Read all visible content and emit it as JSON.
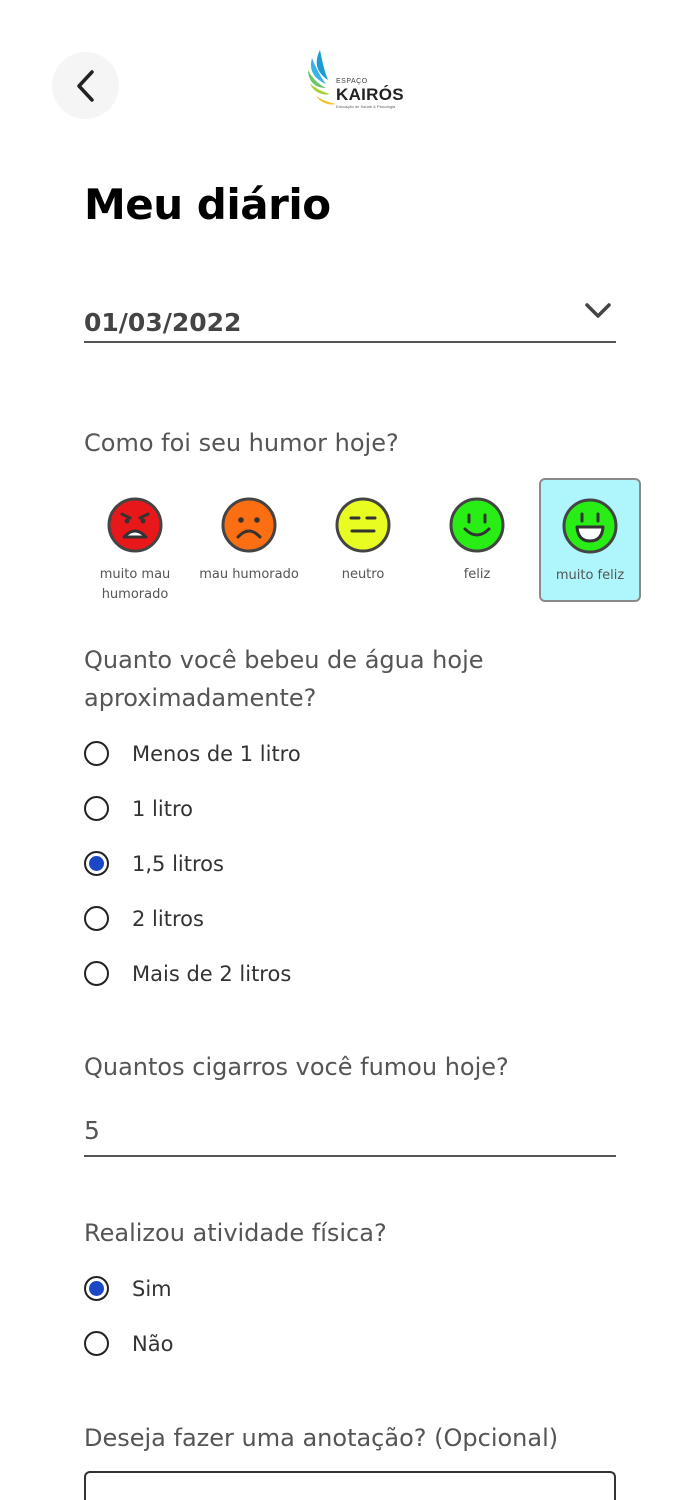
{
  "header": {
    "back_icon": "chevron-left-icon",
    "logo": {
      "small": "ESPAÇO",
      "main": "KAIRÓS",
      "tagline": "Educação de Saúde & Psicologia"
    }
  },
  "page_title": "Meu diário",
  "date": {
    "value": "01/03/2022",
    "icon": "chevron-down-icon"
  },
  "mood": {
    "question": "Como foi seu humor hoje?",
    "options": [
      {
        "label": "muito mau humorado",
        "color": "#e8181a"
      },
      {
        "label": "mau humorado",
        "color": "#fb6f12"
      },
      {
        "label": "neutro",
        "color": "#e8fc22"
      },
      {
        "label": "feliz",
        "color": "#28ee16"
      },
      {
        "label": "muito feliz",
        "color": "#28ee16"
      }
    ],
    "selected": "muito feliz",
    "selected_bg": "#aef6fb"
  },
  "water": {
    "question_line1": "Quanto você bebeu de água hoje",
    "question_line2": "aproximadamente?",
    "options": [
      "Menos de 1 litro",
      "1 litro",
      "1,5 litros",
      "2 litros",
      "Mais de 2 litros"
    ],
    "selected": "1,5 litros"
  },
  "cigarettes": {
    "question": "Quantos cigarros você fumou hoje?",
    "value": "5"
  },
  "exercise": {
    "question": "Realizou atividade física?",
    "options": [
      "Sim",
      "Não"
    ],
    "selected": "Sim"
  },
  "note": {
    "question": "Deseja fazer uma anotação? (Opcional)",
    "value": ""
  },
  "colors": {
    "accent_radio": "#1a46c8",
    "text_question": "#555555"
  }
}
